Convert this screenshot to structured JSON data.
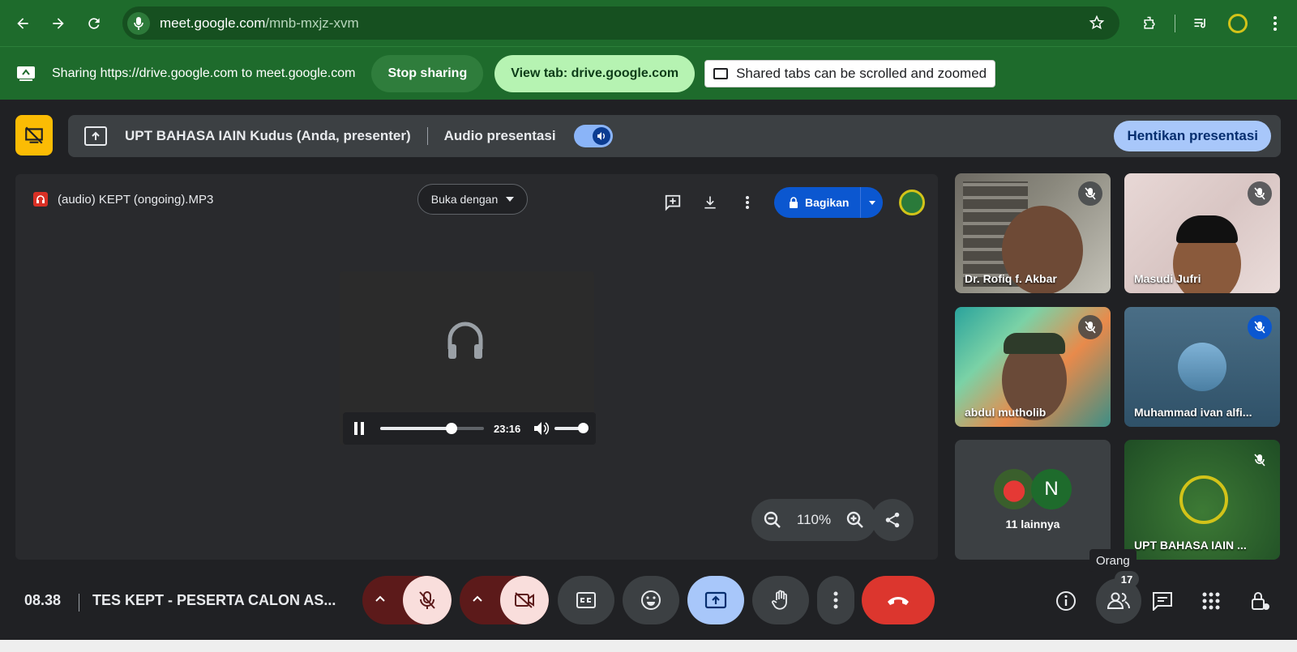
{
  "browser": {
    "url_domain": "meet.google.com",
    "url_path": "/mnb-mxjz-xvm"
  },
  "share_bar": {
    "message": "Sharing https://drive.google.com to meet.google.com",
    "stop_label": "Stop sharing",
    "view_label": "View tab: drive.google.com",
    "note": "Shared tabs can be scrolled and zoomed"
  },
  "presentation": {
    "title": "UPT BAHASA IAIN Kudus (Anda, presenter)",
    "audio_label": "Audio presentasi",
    "audio_on": true,
    "stop_label": "Hentikan presentasi"
  },
  "drive": {
    "file_name": "(audio) KEPT (ongoing).MP3",
    "open_with": "Buka dengan",
    "share_label": "Bagikan",
    "player": {
      "time": "23:16",
      "progress": 0.69,
      "volume": 1.0
    },
    "zoom_level": "110%"
  },
  "participants": [
    {
      "name": "Dr. Rofiq f. Akbar",
      "muted": true
    },
    {
      "name": "Masudi Jufri",
      "muted": true
    },
    {
      "name": "abdul mutholib",
      "muted": true
    },
    {
      "name": "Muhammad ivan alfi...",
      "muted": true
    },
    {
      "name": "11 lainnya",
      "initial": "N"
    },
    {
      "name": "UPT BAHASA IAIN ...",
      "muted": true
    }
  ],
  "bottom_bar": {
    "clock": "08.38",
    "meeting_title": "TES KEPT - PESERTA CALON AS...",
    "people_count": "17",
    "people_tooltip": "Orang"
  },
  "colors": {
    "browser_green": "#1e6b2c",
    "leave_red": "#dc362e",
    "present_blue": "#a8c7fa",
    "share_blue": "#0b57d0"
  }
}
